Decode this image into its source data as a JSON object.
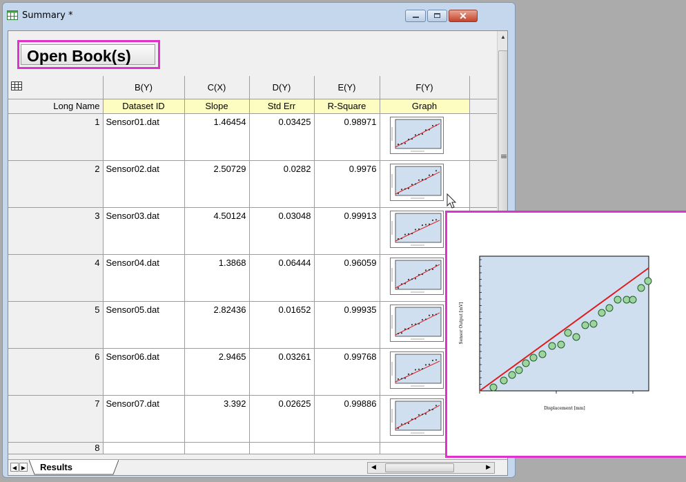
{
  "window": {
    "title": "Summary *",
    "icon": "worksheet-icon",
    "buttons": [
      "minimize-icon",
      "maximize-icon",
      "close-icon"
    ]
  },
  "open_book_button": {
    "label": "Open Book(s)"
  },
  "table": {
    "corner_icon": "sheet-grid-icon",
    "columns": [
      {
        "header": "B(Y)",
        "long_name": "Dataset ID"
      },
      {
        "header": "C(X)",
        "long_name": "Slope"
      },
      {
        "header": "D(Y)",
        "long_name": "Std Err"
      },
      {
        "header": "E(Y)",
        "long_name": "R-Square"
      },
      {
        "header": "F(Y)",
        "long_name": "Graph"
      }
    ],
    "long_name_label": "Long Name",
    "rows": [
      {
        "n": "1",
        "id": "Sensor01.dat",
        "slope": "1.46454",
        "err": "0.03425",
        "r2": "0.98971"
      },
      {
        "n": "2",
        "id": "Sensor02.dat",
        "slope": "2.50729",
        "err": "0.0282",
        "r2": "0.9976"
      },
      {
        "n": "3",
        "id": "Sensor03.dat",
        "slope": "4.50124",
        "err": "0.03048",
        "r2": "0.99913"
      },
      {
        "n": "4",
        "id": "Sensor04.dat",
        "slope": "1.3868",
        "err": "0.06444",
        "r2": "0.96059"
      },
      {
        "n": "5",
        "id": "Sensor05.dat",
        "slope": "2.82436",
        "err": "0.01652",
        "r2": "0.99935"
      },
      {
        "n": "6",
        "id": "Sensor06.dat",
        "slope": "2.9465",
        "err": "0.03261",
        "r2": "0.99768"
      },
      {
        "n": "7",
        "id": "Sensor07.dat",
        "slope": "3.392",
        "err": "0.02625",
        "r2": "0.99886"
      }
    ],
    "empty_row": "8"
  },
  "sheet_tab": {
    "label": "Results"
  },
  "popup_graph": {
    "ylabel": "Sensor Output [mV]",
    "xlabel": "Displacement [mm]",
    "marker_color": "#9fd39f",
    "line_color": "#e01a1a",
    "plot_bg": "#cfdff0"
  }
}
